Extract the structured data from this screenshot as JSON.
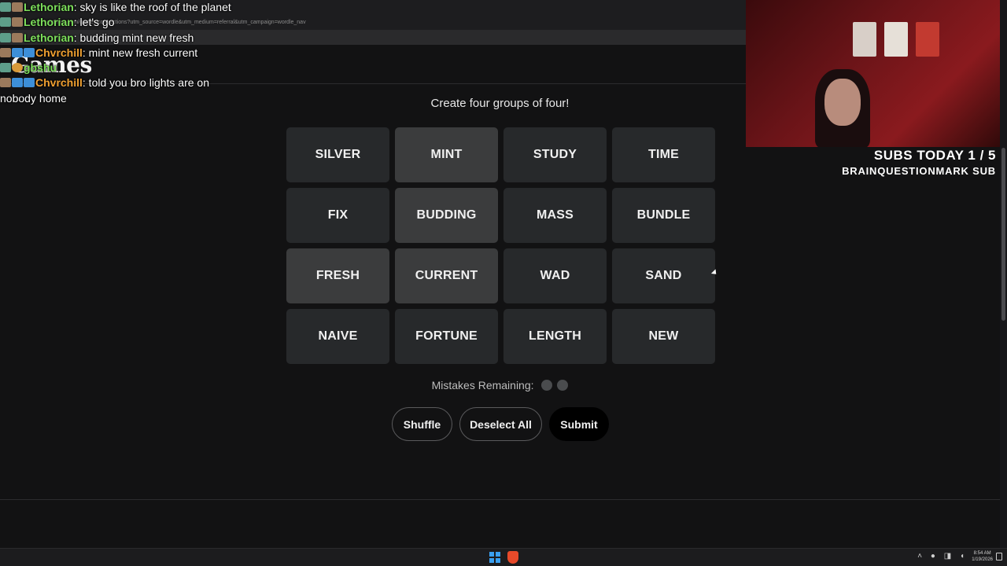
{
  "browser": {
    "url": "nytimes.com/games/connections?utm_source=wordle&utm_medium=referral&utm_campaign=wordle_nav",
    "logo_text": "Games"
  },
  "chat": [
    {
      "user": "Lethorian",
      "user_color": "#7ee05c",
      "message": ": sky is like the roof of the planet",
      "badges": [
        "b1",
        "b2"
      ]
    },
    {
      "user": "Lethorian",
      "user_color": "#7ee05c",
      "message": ": let's go",
      "badges": [
        "b1",
        "b2"
      ]
    },
    {
      "user": "Lethorian",
      "user_color": "#7ee05c",
      "message": ": budding mint new fresh",
      "badges": [
        "b1",
        "b2"
      ]
    },
    {
      "user": "Chvrchill",
      "user_color": "#f0a030",
      "message": ": mint new fresh current",
      "badges": [
        "b2",
        "b3",
        "b3"
      ]
    },
    {
      "user": "gbshu",
      "user_color": "#7ee05c",
      "message": "",
      "badges": [
        "b1",
        "b4"
      ]
    },
    {
      "user": "Chvrchill",
      "user_color": "#f0a030",
      "message": ": told you bro lights are on",
      "badges": [
        "b2",
        "b3",
        "b3"
      ]
    },
    {
      "user": "",
      "user_color": "#ffffff",
      "message": "nobody home",
      "badges": []
    }
  ],
  "game": {
    "subtitle": "Create four groups of four!",
    "tiles": [
      {
        "word": "SILVER",
        "selected": false
      },
      {
        "word": "MINT",
        "selected": true
      },
      {
        "word": "STUDY",
        "selected": false
      },
      {
        "word": "TIME",
        "selected": false
      },
      {
        "word": "FIX",
        "selected": false
      },
      {
        "word": "BUDDING",
        "selected": true
      },
      {
        "word": "MASS",
        "selected": false
      },
      {
        "word": "BUNDLE",
        "selected": false
      },
      {
        "word": "FRESH",
        "selected": true
      },
      {
        "word": "CURRENT",
        "selected": true
      },
      {
        "word": "WAD",
        "selected": false
      },
      {
        "word": "SAND",
        "selected": false
      },
      {
        "word": "NAIVE",
        "selected": false
      },
      {
        "word": "FORTUNE",
        "selected": false
      },
      {
        "word": "LENGTH",
        "selected": false
      },
      {
        "word": "NEW",
        "selected": false
      }
    ],
    "mistakes_label": "Mistakes Remaining:",
    "mistakes_remaining": 2,
    "buttons": {
      "shuffle": "Shuffle",
      "deselect": "Deselect All",
      "submit": "Submit"
    }
  },
  "overlay": {
    "subs_line1": "SUBS TODAY 1 / 5",
    "subs_line2": "BRAINQUESTIONMARK SUB"
  },
  "taskbar": {
    "time": "8:54 AM",
    "date": "1/19/2026"
  },
  "colors": {
    "background": "#121213",
    "tile": "#27292b",
    "tile_selected": "#3b3c3d",
    "submit_bg": "#000000"
  }
}
